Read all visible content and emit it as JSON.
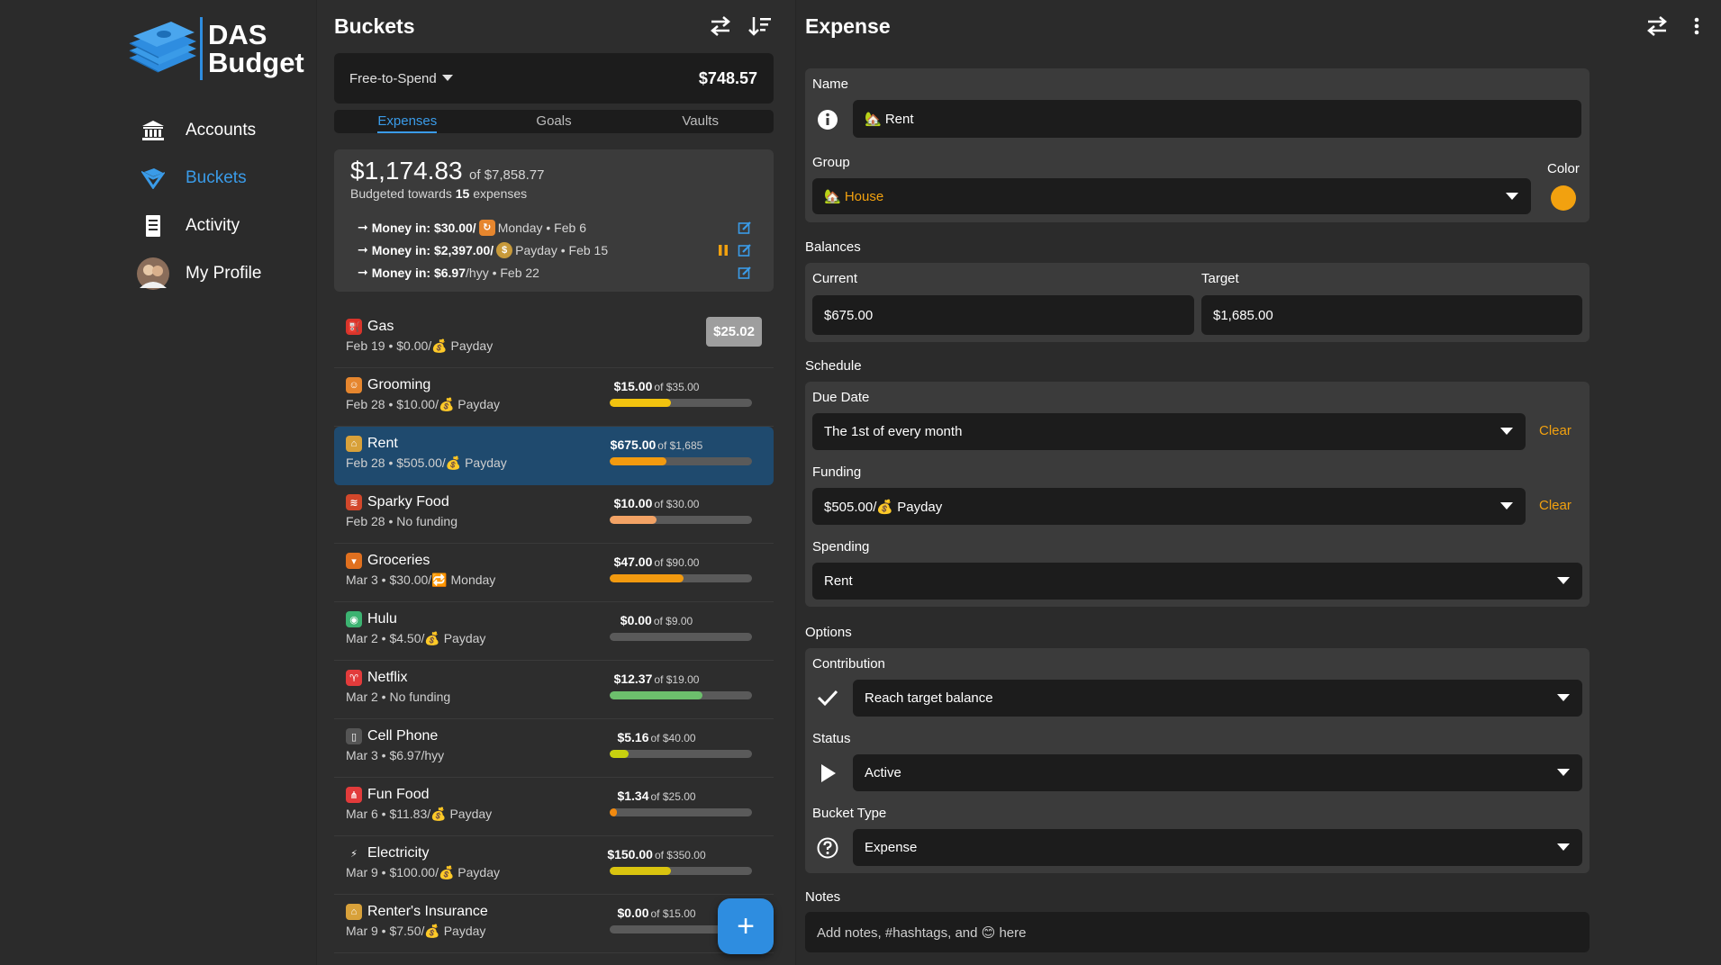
{
  "app": {
    "logo_line1": "DAS",
    "logo_line2": "Budget"
  },
  "nav": [
    {
      "label": "Accounts",
      "icon": "bank-icon",
      "active": false
    },
    {
      "label": "Buckets",
      "icon": "bucket-icon",
      "active": true
    },
    {
      "label": "Activity",
      "icon": "receipt-icon",
      "active": false
    },
    {
      "label": "My Profile",
      "icon": "avatar",
      "active": false
    }
  ],
  "buckets_panel": {
    "title": "Buckets",
    "free_to_spend_label": "Free-to-Spend",
    "free_to_spend_amount": "$748.57",
    "tabs": [
      "Expenses",
      "Goals",
      "Vaults"
    ],
    "summary": {
      "amount": "$1,174.83",
      "of_total": "of $7,858.77",
      "budgeted_prefix": "Budgeted towards",
      "budgeted_count": "15",
      "budgeted_suffix": "expenses",
      "money_in": [
        {
          "label": "Money in:",
          "amount": "$30.00/",
          "icon": "calendar-icon",
          "schedule": "Monday • Feb 6"
        },
        {
          "label": "Money in:",
          "amount": "$2,397.00/",
          "icon": "money-bag-icon",
          "schedule": "Payday • Feb 15"
        },
        {
          "label": "Money in:",
          "amount": "$6.97",
          "icon": "",
          "schedule": "/hyy • Feb 22"
        }
      ]
    },
    "buckets": [
      {
        "name": "Gas",
        "icon": "fuel-icon",
        "icon_bg": "#d9342b",
        "icon_char": "⛽",
        "sub": "Feb 19 • $0.00/💰 Payday",
        "badge": "$25.02"
      },
      {
        "name": "Grooming",
        "icon": "person-icon",
        "icon_bg": "#e6862e",
        "icon_char": "☺",
        "sub": "Feb 28 • $10.00/💰 Payday",
        "amount": "$15.00",
        "of": "of $35.00",
        "fill": 0.43,
        "color": "#f2c30f"
      },
      {
        "name": "Rent",
        "icon": "house-icon",
        "icon_bg": "#d8a13a",
        "icon_char": "⌂",
        "sub": "Feb 28 • $505.00/💰 Payday",
        "amount": "$675.00",
        "of": "of $1,685",
        "fill": 0.4,
        "color": "#f29a0f",
        "active": true
      },
      {
        "name": "Sparky Food",
        "icon": "bacon-icon",
        "icon_bg": "#d2472b",
        "icon_char": "≋",
        "sub": "Feb 28 • No funding",
        "amount": "$10.00",
        "of": "of $30.00",
        "fill": 0.33,
        "color": "#f2a265"
      },
      {
        "name": "Groceries",
        "icon": "carrot-icon",
        "icon_bg": "#e0701f",
        "icon_char": "▾",
        "sub": "Mar 3 • $30.00/🔁 Monday",
        "amount": "$47.00",
        "of": "of $90.00",
        "fill": 0.52,
        "color": "#f29a0f"
      },
      {
        "name": "Hulu",
        "icon": "hulu-icon",
        "icon_bg": "#3cb371",
        "icon_char": "◉",
        "sub": "Mar 2 • $4.50/💰 Payday",
        "amount": "$0.00",
        "of": "of $9.00",
        "fill": 0.0,
        "color": "#6cbf6c"
      },
      {
        "name": "Netflix",
        "icon": "netflix-icon",
        "icon_bg": "#e23b3b",
        "icon_char": "♈",
        "sub": "Mar 2 • No funding",
        "amount": "$12.37",
        "of": "of $19.00",
        "fill": 0.65,
        "color": "#6cbf6c"
      },
      {
        "name": "Cell Phone",
        "icon": "phone-icon",
        "icon_bg": "#555555",
        "icon_char": "▯",
        "sub": "Mar 3 • $6.97/hyy",
        "amount": "$5.16",
        "of": "of $40.00",
        "fill": 0.13,
        "color": "#c7d10f"
      },
      {
        "name": "Fun Food",
        "icon": "fries-icon",
        "icon_bg": "#e23b3b",
        "icon_char": "⋔",
        "sub": "Mar 6 • $11.83/💰 Payday",
        "amount": "$1.34",
        "of": "of $25.00",
        "fill": 0.05,
        "color": "#f28a0f"
      },
      {
        "name": "Electricity",
        "icon": "lightning-icon",
        "icon_bg": "transparent",
        "icon_char": "⚡",
        "sub": "Mar 9 • $100.00/💰 Payday",
        "amount": "$150.00",
        "of": "of $350.00",
        "fill": 0.43,
        "color": "#d9c40f"
      },
      {
        "name": "Renter's Insurance",
        "icon": "house-icon",
        "icon_bg": "#d8a13a",
        "icon_char": "⌂",
        "sub": "Mar 9 • $7.50/💰 Payday",
        "amount": "$0.00",
        "of": "of $15.00",
        "fill": 0.0,
        "color": "#f29a0f"
      }
    ],
    "fab_label": "+"
  },
  "expense_panel": {
    "title": "Expense",
    "name_label": "Name",
    "name_value": "🏡 Rent",
    "group_label": "Group",
    "group_value": "🏡 House",
    "color_label": "Color",
    "color_value": "#f2a10f",
    "balances_label": "Balances",
    "current_label": "Current",
    "current_value": "$675.00",
    "target_label": "Target",
    "target_value": "$1,685.00",
    "schedule_label": "Schedule",
    "due_label": "Due Date",
    "due_value": "The 1st of every month",
    "clear_label": "Clear",
    "funding_label": "Funding",
    "funding_value": "$505.00/💰 Payday",
    "spending_label": "Spending",
    "spending_value": "Rent",
    "options_label": "Options",
    "contribution_label": "Contribution",
    "contribution_value": "Reach target balance",
    "status_label": "Status",
    "status_value": "Active",
    "type_label": "Bucket Type",
    "type_value": "Expense",
    "notes_label": "Notes",
    "notes_placeholder": "Add notes, #hashtags, and 😊 here"
  },
  "colors": {
    "accent": "#2e8de0",
    "orange": "#f2a10f",
    "selected_row": "#1f4a6e"
  }
}
